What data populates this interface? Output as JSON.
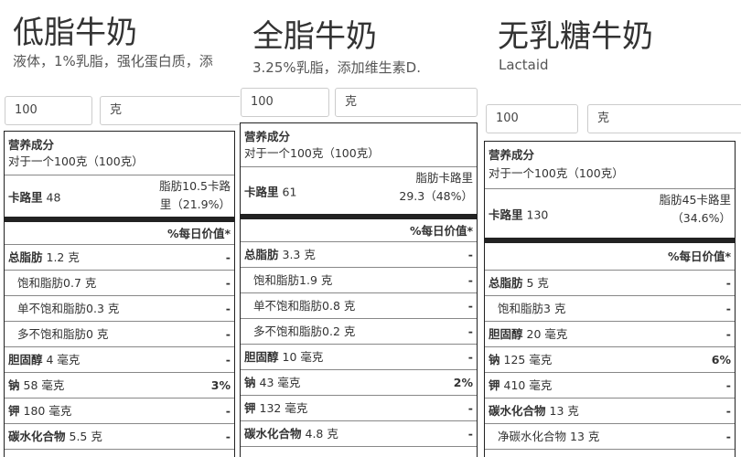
{
  "panels": [
    {
      "title": "低脂牛奶",
      "subtitle": "液体，1%乳脂，强化蛋白质，添",
      "qty_value": "100",
      "unit_value": "克",
      "label": {
        "header": "营养成分",
        "serving": "对于一个100克（100克）",
        "calories_label": "卡路里",
        "calories_value": "48",
        "fat_calories_line1": "脂肪10.5卡路",
        "fat_calories_line2": "里（21.9%）",
        "dv_header": "%每日价值*",
        "rows": [
          {
            "name": "总脂肪",
            "amount": "1.2 克",
            "dv": "-"
          },
          {
            "name": "饱和脂肪",
            "amount": "0.7 克",
            "dv": "-"
          },
          {
            "name": "单不饱和脂肪",
            "amount": "0.3 克",
            "dv": "-"
          },
          {
            "name": "多不饱和脂肪",
            "amount": "0 克",
            "dv": "-"
          },
          {
            "name": "胆固醇",
            "amount": "4 毫克",
            "dv": "-"
          },
          {
            "name": "钠",
            "amount": "58 毫克",
            "dv": "3%"
          },
          {
            "name": "钾",
            "amount": "180 毫克",
            "dv": "-"
          },
          {
            "name": "碳水化合物",
            "amount": "5.5 克",
            "dv": "-"
          }
        ]
      }
    },
    {
      "title": "全脂牛奶",
      "subtitle": "3.25%乳脂，添加维生素D.",
      "qty_value": "100",
      "unit_value": "克",
      "label": {
        "header": "营养成分",
        "serving": "对于一个100克（100克）",
        "calories_label": "卡路里",
        "calories_value": "61",
        "fat_calories_line1": "脂肪卡路里",
        "fat_calories_line2": "29.3（48%）",
        "dv_header": "%每日价值*",
        "rows": [
          {
            "name": "总脂肪",
            "amount": "3.3 克",
            "dv": "-"
          },
          {
            "name": "饱和脂肪",
            "amount": "1.9 克",
            "dv": "-"
          },
          {
            "name": "单不饱和脂肪",
            "amount": "0.8 克",
            "dv": "-"
          },
          {
            "name": "多不饱和脂肪",
            "amount": "0.2 克",
            "dv": "-"
          },
          {
            "name": "胆固醇",
            "amount": "10 毫克",
            "dv": "-"
          },
          {
            "name": "钠",
            "amount": "43 毫克",
            "dv": "2%"
          },
          {
            "name": "钾",
            "amount": "132 毫克",
            "dv": "-"
          },
          {
            "name": "碳水化合物",
            "amount": "4.8 克",
            "dv": "-"
          }
        ]
      }
    },
    {
      "title": "无乳糖牛奶",
      "subtitle": "Lactaid",
      "qty_value": "100",
      "unit_value": "克",
      "label": {
        "header": "营养成分",
        "serving": "对于一个100克（100克）",
        "calories_label": "卡路里",
        "calories_value": "130",
        "fat_calories_line1": "脂肪45卡路里",
        "fat_calories_line2": "（34.6%）",
        "dv_header": "%每日价值*",
        "rows": [
          {
            "name": "总脂肪",
            "amount": "5 克",
            "dv": "-"
          },
          {
            "name": "饱和脂肪",
            "amount": "3 克",
            "dv": "-"
          },
          {
            "name": "胆固醇",
            "amount": "20 毫克",
            "dv": "-"
          },
          {
            "name": "钠",
            "amount": "125 毫克",
            "dv": "6%"
          },
          {
            "name": "钾",
            "amount": "410 毫克",
            "dv": "-"
          },
          {
            "name": "碳水化合物",
            "amount": "13 克",
            "dv": "-"
          },
          {
            "name": "净碳水化合物",
            "amount": "13 克",
            "dv": "-"
          }
        ]
      }
    }
  ]
}
